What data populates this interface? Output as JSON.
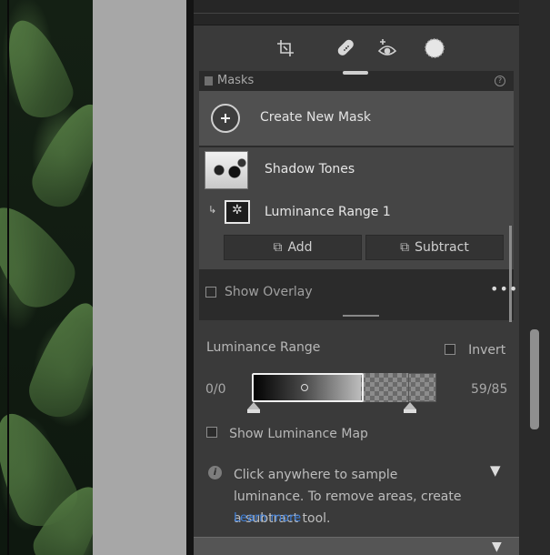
{
  "toolbar": {
    "tools": [
      "crop-icon",
      "heal-icon",
      "redeye-icon",
      "masking-icon"
    ]
  },
  "masks": {
    "title": "Masks",
    "help_icon": "?",
    "create_label": "Create New Mask",
    "mask_name": "Shadow Tones",
    "submask_name": "Luminance Range 1",
    "add_label": "Add",
    "subtract_label": "Subtract",
    "show_overlay_label": "Show Overlay",
    "more_label": "•••"
  },
  "luminance": {
    "title": "Luminance Range",
    "invert_label": "Invert",
    "range_left": "0/0",
    "range_right": "59/85",
    "show_map_label": "Show Luminance Map",
    "info_text": "Click anywhere to sample luminance. To remove areas, create a subtract tool.",
    "learn_more": "Learn more"
  },
  "colors": {
    "panel": "#3a3a3a",
    "accent_link": "#3f7ed6"
  }
}
